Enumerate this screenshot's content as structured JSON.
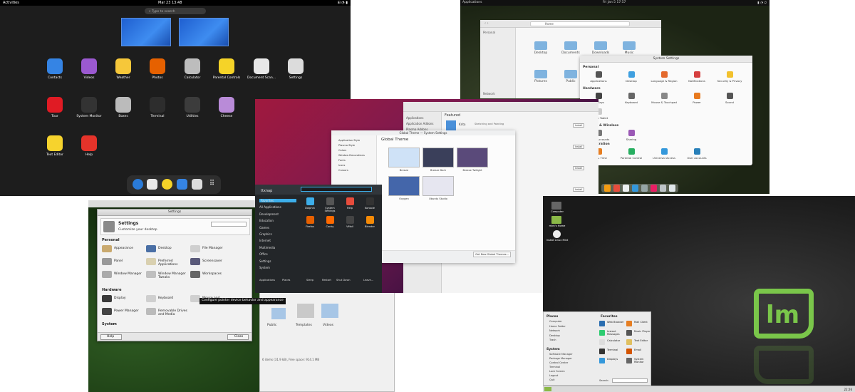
{
  "gnome": {
    "activities": "Activities",
    "clock": "Mar 23  13:48",
    "search_placeholder": "Type to search",
    "apps": [
      {
        "label": "Contacts",
        "color": "#3584e4"
      },
      {
        "label": "Videos",
        "color": "#9b59d0"
      },
      {
        "label": "Weather",
        "color": "#f6c73a"
      },
      {
        "label": "Photos",
        "color": "#e66100"
      },
      {
        "label": "Calculator",
        "color": "#bdbdbd"
      },
      {
        "label": "Parental Controls",
        "color": "#f5d328"
      },
      {
        "label": "Document Scan...",
        "color": "#e8e8e8"
      },
      {
        "label": "Settings",
        "color": "#dcdcdc"
      },
      {
        "label": "Tour",
        "color": "#e01b24"
      },
      {
        "label": "System Monitor",
        "color": "#333333"
      },
      {
        "label": "Boxes",
        "color": "#bbbbbb"
      },
      {
        "label": "Terminal",
        "color": "#2d2d2d"
      },
      {
        "label": "Utilities",
        "color": "#3c3c3c"
      },
      {
        "label": "Cheese",
        "color": "#b98bd8"
      },
      {
        "label": "Text Editor",
        "color": "#f6d32d"
      },
      {
        "label": "Help",
        "color": "#e5332a"
      }
    ]
  },
  "elementary": {
    "applications": "Applications",
    "clock": "Fri Jan 5   17:57",
    "files": {
      "path": "Home",
      "sidebar_title": "Personal",
      "network": "Network",
      "folders": [
        "Desktop",
        "Documents",
        "Downloads",
        "Music",
        "Pictures",
        "Public"
      ]
    },
    "settings": {
      "title": "System Settings",
      "sections": [
        "Personal",
        "Hardware",
        "Network & Wireless",
        "Administration"
      ],
      "personal": [
        "Applications",
        "Desktop",
        "Language & Region",
        "Notifications",
        "Security & Privacy"
      ],
      "hardware": [
        "Displays",
        "Keyboard",
        "Mouse & Touchpad",
        "Power",
        "Sound",
        "Wacom Tablet"
      ],
      "network": [
        "Online Accounts",
        "Sharing"
      ],
      "admin": [
        "Date & Time",
        "Parental Control",
        "Universal Access",
        "User Accounts"
      ]
    }
  },
  "ubuntu": {
    "store_title": "Featured",
    "store_sidebar": [
      "Applications",
      "Application Addons",
      "Plasma Addons"
    ],
    "store_item": "Krita",
    "store_item_desc": "Sketching and Painting",
    "install": "Install",
    "kde_settings": {
      "window_title": "Global Theme — System Settings",
      "heading": "Global Theme",
      "sidebar": [
        "Application Style",
        "Plasma Style",
        "Colors",
        "Window Decorations",
        "Fonts",
        "Icons",
        "Cursors"
      ],
      "themes": [
        "Breeze",
        "Breeze Dark",
        "Breeze Twilight",
        "Oxygen",
        "Ubuntu Studio"
      ],
      "footer_left": "Use desktop layout from theme",
      "get_new": "Get New Global Themes..."
    },
    "menu": {
      "user": "ttxnap",
      "categories": [
        "Favorites",
        "All Applications",
        "Development",
        "Education",
        "Games",
        "Graphics",
        "Internet",
        "Multimedia",
        "Office",
        "Settings",
        "System"
      ],
      "apps": [
        "Dolphin",
        "System Settings",
        "Help",
        "Konsole",
        "Firefox",
        "Conky",
        "VMail",
        "Blender"
      ],
      "bottom": [
        "Applications",
        "Places",
        "Sleep",
        "Restart",
        "Shut Down",
        "Leave..."
      ]
    }
  },
  "xfce": {
    "window_title": "Settings",
    "header_title": "Settings",
    "header_subtitle": "Customize your desktop",
    "sections": [
      "Personal",
      "Hardware",
      "System"
    ],
    "personal": [
      "Appearance",
      "Desktop",
      "File Manager",
      "Panel",
      "Preferred Applications",
      "Screensaver",
      "Window Manager",
      "Window Manager Tweaks",
      "Workspaces"
    ],
    "hardware": [
      "Display",
      "Keyboard",
      "Mouse and Touchpad",
      "Power Manager",
      "Removable Drives and Media"
    ],
    "tooltip": "Configure pointer device behavior and appearance",
    "help": "Help",
    "close": "Close",
    "fm_items": [
      "Public",
      "Templates",
      "Videos"
    ],
    "status": "6 items (31.9 kB), Free space: 914.1 MB"
  },
  "mint": {
    "desktop": [
      "Computer",
      "mint's Home",
      "Install Linux Mint"
    ],
    "places_title": "Places",
    "places": [
      "Computer",
      "Home Folder",
      "Network",
      "Desktop",
      "Trash"
    ],
    "system_title": "System",
    "system": [
      "Software Manager",
      "Package Manager",
      "Control Center",
      "Terminal",
      "Lock Screen",
      "Logout",
      "Quit"
    ],
    "favorites_title": "Favorites",
    "favorites": [
      "Web Browser",
      "Instant Messages",
      "Calculator",
      "Terminal",
      "Displays",
      "Mail Client",
      "Music Player",
      "Text Editor",
      "Email",
      "System Monitor"
    ],
    "search_label": "Search:",
    "clock": "22:26"
  }
}
